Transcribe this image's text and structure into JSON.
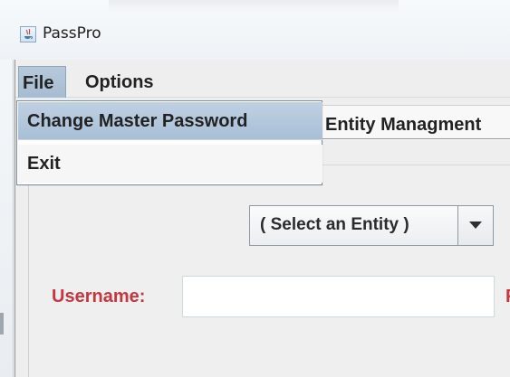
{
  "window": {
    "title": "PassPro"
  },
  "menubar": {
    "file_label": "File",
    "options_label": "Options"
  },
  "file_menu": {
    "items": [
      {
        "label": "Change Master Password"
      },
      {
        "label": "Exit"
      }
    ]
  },
  "tabs": {
    "entity_management_label": "Entity Managment"
  },
  "entity_select": {
    "selected": "( Select an Entity )"
  },
  "form": {
    "username_label": "Username:",
    "username_value": "",
    "truncated_label_text": "P"
  },
  "colors": {
    "accent_label_red": "#c4373f",
    "menu_highlight_blue": "#a8bfd6",
    "window_background": "#eeeeee"
  },
  "icons": {
    "app": "java-app-icon",
    "dropdown": "chevron-down-icon"
  }
}
